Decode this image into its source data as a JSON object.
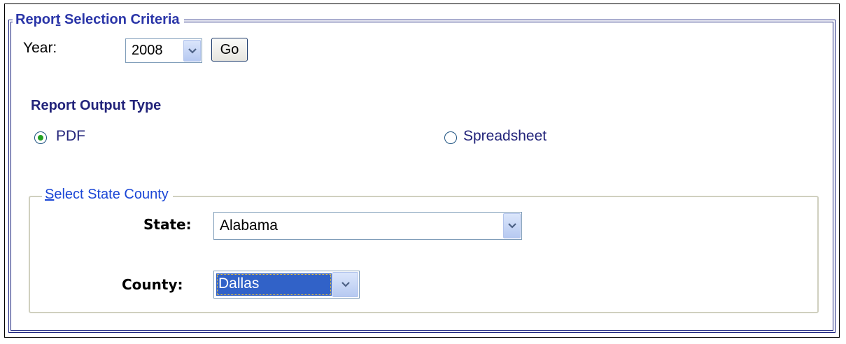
{
  "criteria": {
    "legend_before": "Repor",
    "legend_accesskey": "t",
    "legend_after": " Selection Criteria"
  },
  "year": {
    "label": "Year:",
    "selected": "2008",
    "go_label": "Go"
  },
  "output": {
    "heading": "Report Output Type",
    "options": [
      {
        "label": "PDF",
        "checked": true
      },
      {
        "label": "Spreadsheet",
        "checked": false
      }
    ]
  },
  "location": {
    "legend_accesskey": "S",
    "legend_after": "elect State County",
    "state_label": "State:",
    "state_selected": "Alabama",
    "county_label": "County:",
    "county_selected": "Dallas"
  },
  "colors": {
    "frame": "#1a237e",
    "radio_dot": "#21a121",
    "selection": "#3162c8"
  }
}
